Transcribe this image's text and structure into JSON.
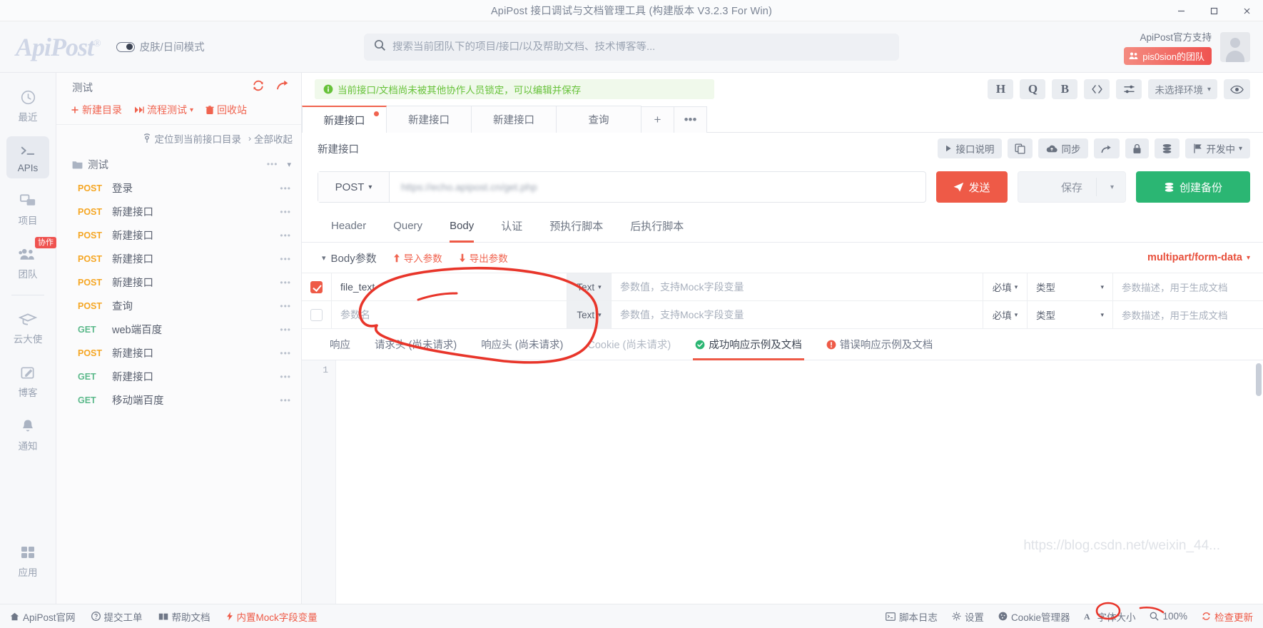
{
  "window": {
    "title": "ApiPost 接口调试与文档管理工具 (构建版本 V3.2.3 For Win)",
    "minimize": "─",
    "maximize": "❐",
    "close": "✕"
  },
  "header": {
    "logo": "ApiPost",
    "logo_reg": "®",
    "skin_mode": "皮肤/日间模式",
    "search_placeholder": "搜索当前团队下的项目/接口/以及帮助文档、技术博客等...",
    "search_value": "",
    "official_support": "ApiPost官方支持",
    "team_badge": "pis0sion的团队"
  },
  "rail": {
    "items": [
      {
        "label": "最近",
        "icon": "clock-icon",
        "active": false
      },
      {
        "label": "APIs",
        "icon": "terminal-icon",
        "active": true
      },
      {
        "label": "项目",
        "icon": "layers-icon",
        "active": false
      },
      {
        "label": "团队",
        "icon": "people-icon",
        "active": false,
        "badge": "协作"
      },
      {
        "label": "云大使",
        "icon": "graduation-cap-icon",
        "active": false
      },
      {
        "label": "博客",
        "icon": "pencil-square-icon",
        "active": false
      },
      {
        "label": "通知",
        "icon": "bell-icon",
        "active": false
      }
    ],
    "bottom": {
      "label": "应用",
      "icon": "grid-icon"
    }
  },
  "tree": {
    "title": "测试",
    "refresh_icon": "refresh-icon",
    "share_icon": "share-arrow-icon",
    "actions": [
      {
        "label": "新建目录",
        "icon": "plus-icon"
      },
      {
        "label": "流程测试",
        "icon": "fast-forward-icon",
        "caret": "▾"
      },
      {
        "label": "回收站",
        "icon": "trash-icon"
      }
    ],
    "sub_actions": [
      {
        "label": "定位到当前接口目录",
        "icon": "locate-icon"
      },
      {
        "label": "全部收起",
        "icon": "chevron-right-icon"
      }
    ],
    "collapse_icon": "chevron-down-icon",
    "folder": {
      "name": "测试",
      "icon": "folder-icon",
      "dots": "•••"
    },
    "apis": [
      {
        "method": "POST",
        "name": "登录"
      },
      {
        "method": "POST",
        "name": "新建接口"
      },
      {
        "method": "POST",
        "name": "新建接口"
      },
      {
        "method": "POST",
        "name": "新建接口"
      },
      {
        "method": "POST",
        "name": "新建接口"
      },
      {
        "method": "POST",
        "name": "查询"
      },
      {
        "method": "GET",
        "name": "web端百度"
      },
      {
        "method": "POST",
        "name": "新建接口"
      },
      {
        "method": "GET",
        "name": "新建接口"
      },
      {
        "method": "GET",
        "name": "移动端百度"
      }
    ],
    "row_dots": "•••"
  },
  "main": {
    "notice": "当前接口/文档尚未被其他协作人员锁定，可以编辑并保存",
    "notice_icon": "info-circle-icon",
    "toolbar": [
      {
        "label": "H",
        "name": "header-preset-button",
        "serif": true
      },
      {
        "label": "Q",
        "name": "query-preset-button",
        "serif": true
      },
      {
        "label": "B",
        "name": "body-preset-button",
        "serif": true
      },
      {
        "label": "‹›",
        "name": "code-view-button",
        "serif": false
      },
      {
        "label": "⨍",
        "name": "settings-sliders-button",
        "serif": false
      }
    ],
    "env_label": "未选择环境",
    "env_caret": "▾",
    "eye_icon": "eye-icon",
    "tabs": [
      {
        "label": "新建接口",
        "active": true,
        "dirty": true
      },
      {
        "label": "新建接口",
        "active": false,
        "dirty": false
      },
      {
        "label": "新建接口",
        "active": false,
        "dirty": false
      },
      {
        "label": "查询",
        "active": false,
        "dirty": false
      }
    ],
    "tab_add": "+",
    "tab_more": "•••",
    "iface_name": "新建接口",
    "iface_tools": [
      {
        "label": "接口说明",
        "icon": "play-triangle-icon",
        "name": "interface-doc-button"
      },
      {
        "label": "",
        "icon": "copy-icon",
        "name": "copy-button"
      },
      {
        "label": "同步",
        "icon": "cloud-upload-icon",
        "name": "sync-button"
      },
      {
        "label": "",
        "icon": "share-arrow-icon",
        "name": "share-button"
      },
      {
        "label": "",
        "icon": "lock-icon",
        "name": "lock-button"
      },
      {
        "label": "",
        "icon": "database-icon",
        "name": "database-button"
      },
      {
        "label": "开发中",
        "icon": "flag-icon",
        "name": "status-dropdown",
        "caret": "▾"
      }
    ],
    "method": "POST",
    "method_caret": "▾",
    "url_value": "https://echo.apipost.cn/get.php",
    "send_label": "发送",
    "send_icon": "paper-plane-icon",
    "save_label": "保存",
    "save_caret": "▾",
    "backup_label": "创建备份",
    "backup_icon": "database-icon",
    "req_tabs": [
      {
        "label": "Header",
        "active": false
      },
      {
        "label": "Query",
        "active": false
      },
      {
        "label": "Body",
        "active": true
      },
      {
        "label": "认证",
        "active": false
      },
      {
        "label": "预执行脚本",
        "active": false
      },
      {
        "label": "后执行脚本",
        "active": false
      }
    ],
    "body_params": {
      "title": "Body参数",
      "collapse_caret": "▾",
      "import_label": "导入参数",
      "import_icon": "arrow-up-icon",
      "export_label": "导出参数",
      "export_icon": "arrow-down-icon",
      "content_type": "multipart/form-data",
      "content_type_caret": "▾",
      "columns": {
        "name_placeholder": "参数名",
        "type": "Text",
        "type_caret": "▾",
        "value_placeholder": "参数值，支持Mock字段变量",
        "required": "必填",
        "required_caret": "▾",
        "kind": "类型",
        "kind_caret": "▾",
        "desc_placeholder": "参数描述，用于生成文档"
      },
      "rows": [
        {
          "checked": true,
          "name": "file_text",
          "type": "Text",
          "value": "",
          "required": "必填",
          "kind": "类型",
          "desc": ""
        },
        {
          "checked": false,
          "name": "",
          "type": "Text",
          "value": "",
          "required": "必填",
          "kind": "类型",
          "desc": ""
        }
      ]
    },
    "resp_tabs": [
      {
        "label": "响应",
        "active": false,
        "dim": false,
        "icon": ""
      },
      {
        "label": "请求头 (尚未请求)",
        "active": false,
        "dim": false,
        "icon": ""
      },
      {
        "label": "响应头 (尚未请求)",
        "active": false,
        "dim": false,
        "icon": ""
      },
      {
        "label": "Cookie (尚未请求)",
        "active": false,
        "dim": true,
        "icon": ""
      },
      {
        "label": "成功响应示例及文档",
        "active": true,
        "dim": false,
        "icon": "check-circle-icon"
      },
      {
        "label": "错误响应示例及文档",
        "active": false,
        "dim": false,
        "icon": "error-circle-icon"
      }
    ],
    "editor_line_numbers": [
      "1"
    ],
    "editor_content": ""
  },
  "status": {
    "left": [
      {
        "label": "ApiPost官网",
        "icon": "home-icon",
        "red": false
      },
      {
        "label": "提交工单",
        "icon": "question-circle-icon",
        "red": false
      },
      {
        "label": "帮助文档",
        "icon": "book-icon",
        "red": false
      },
      {
        "label": "内置Mock字段变量",
        "icon": "lightning-icon",
        "red": true
      }
    ],
    "right": [
      {
        "label": "脚本日志",
        "icon": "terminal-small-icon",
        "red": false
      },
      {
        "label": "设置",
        "icon": "gear-icon",
        "red": false
      },
      {
        "label": "Cookie管理器",
        "icon": "cookie-icon",
        "red": false
      },
      {
        "label": "字体大小",
        "icon": "font-size-icon",
        "red": false
      },
      {
        "label": "100%",
        "icon": "zoom-icon",
        "red": false
      },
      {
        "label": "检查更新",
        "icon": "refresh-small-icon",
        "red": true
      }
    ]
  },
  "watermark": "https://blog.csdn.net/weixin_44...",
  "colors": {
    "accent_red": "#ee5a47",
    "green": "#2bb673",
    "orange": "#f5a623",
    "get_green": "#5cb98b",
    "notice_bg": "#f0f9eb",
    "annotation_red": "#e8352a"
  }
}
